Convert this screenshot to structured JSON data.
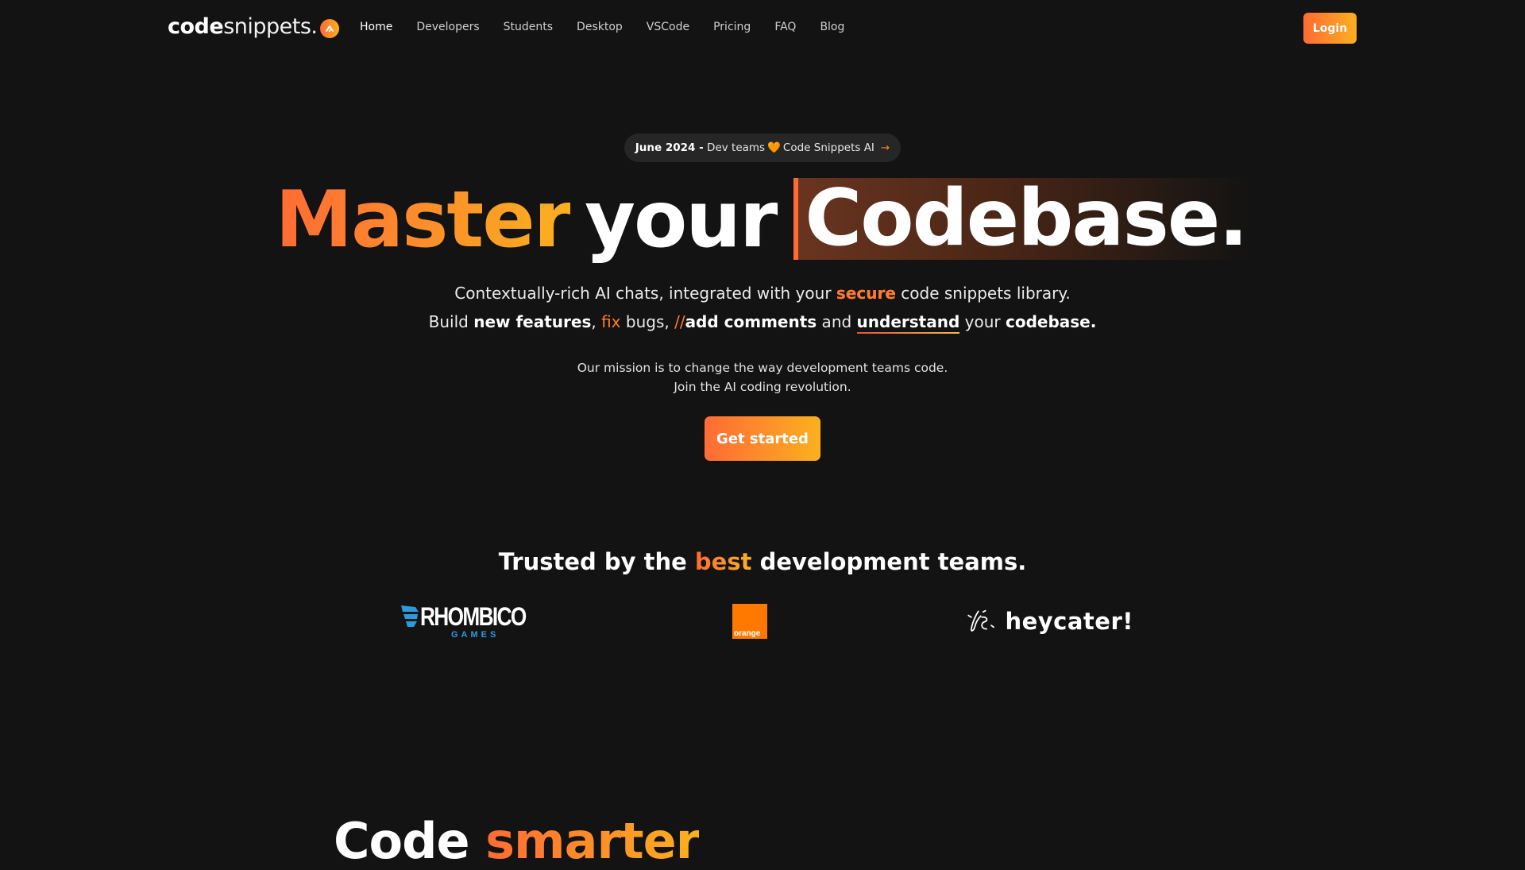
{
  "brand": {
    "name_bold": "code",
    "name_light": "snippets.",
    "logo_icon": "chevron-up-badge-icon",
    "accent_start": "#ff6b35",
    "accent_end": "#fbb01f",
    "background": "#131313"
  },
  "nav": {
    "items": [
      {
        "label": "Home",
        "active": true
      },
      {
        "label": "Developers"
      },
      {
        "label": "Students"
      },
      {
        "label": "Desktop"
      },
      {
        "label": "VSCode"
      },
      {
        "label": "Pricing"
      },
      {
        "label": "FAQ"
      },
      {
        "label": "Blog"
      }
    ],
    "login_label": "Login"
  },
  "announcement": {
    "date": "June 2024 -",
    "text_before": "Dev teams",
    "icon": "orange-heart-icon",
    "heart_glyph": "🧡",
    "text_after": "Code Snippets AI",
    "arrow_glyph": "→"
  },
  "hero": {
    "headline_accent": "Master",
    "headline_mid": "your",
    "headline_highlight": "Codebase.",
    "subtitle1": {
      "before": "Contextually-rich AI chats, integrated with your ",
      "accent": "secure",
      "after": " code snippets library."
    },
    "subtitle2": {
      "build": "Build ",
      "new_features": "new features",
      "comma1": ", ",
      "fix": "fix",
      "bugs": " bugs, ",
      "slashes": "//",
      "add_comments": "add comments",
      "and": " and ",
      "understand": "understand",
      "your": " your ",
      "codebase": "codebase."
    },
    "mission_line1": "Our mission is to change the way development teams code.",
    "mission_line2": "Join the AI coding revolution.",
    "cta_label": "Get started"
  },
  "trusted": {
    "before": "Trusted by the ",
    "accent": "best",
    "after": " development teams.",
    "logos": [
      {
        "name": "RHOMBICO",
        "sub": "GAMES"
      },
      {
        "name": "orange"
      },
      {
        "name": "heycater!"
      }
    ]
  },
  "section2": {
    "title_plain": "Code",
    "title_accent": "smarter"
  }
}
